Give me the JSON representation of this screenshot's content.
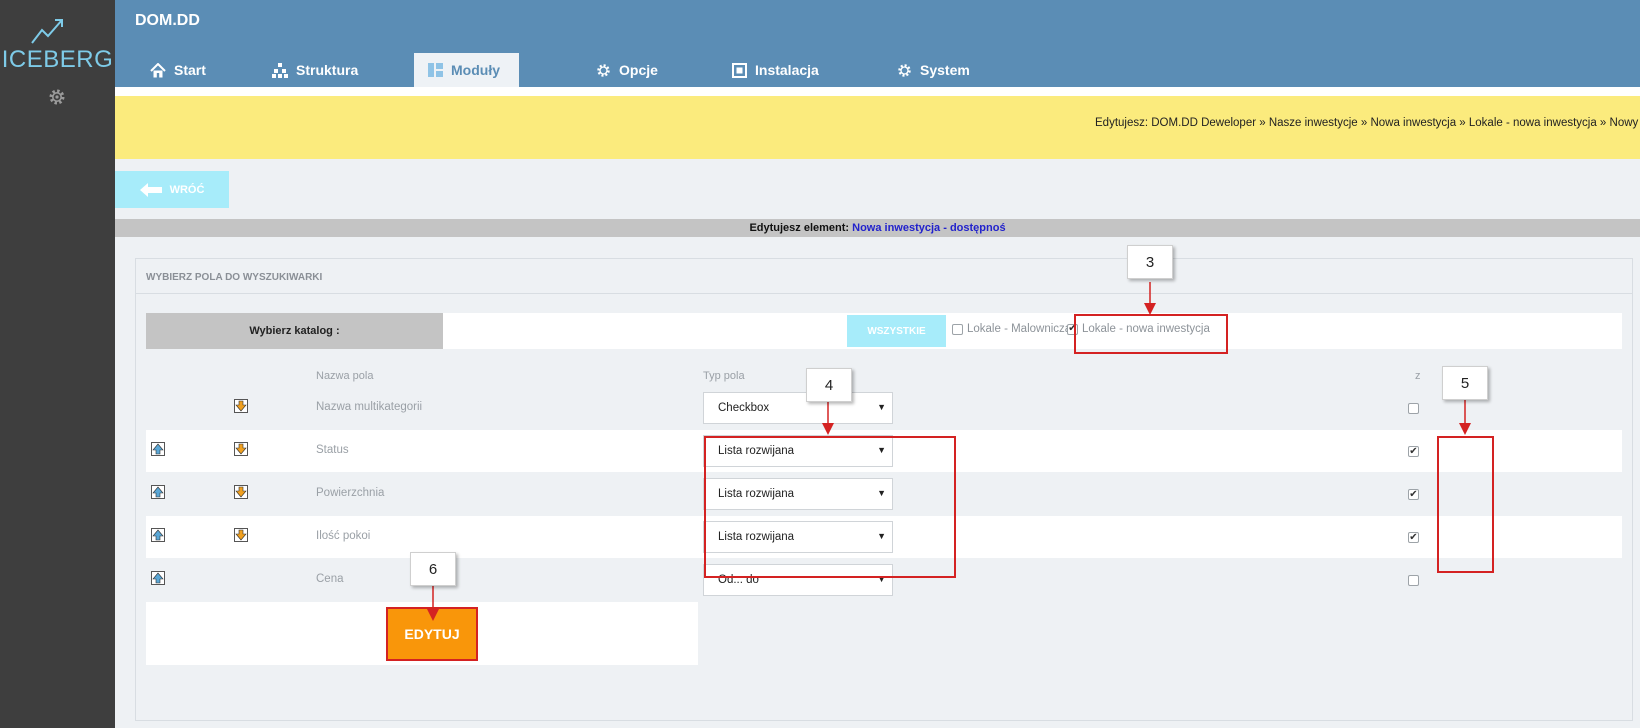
{
  "app": {
    "logo_text": "ICEBERG",
    "logo_icon": "trend-line-icon",
    "settings_icon": "gear-icon",
    "site_title": "DOM.DD"
  },
  "nav": {
    "tabs": [
      {
        "label": "Start",
        "icon": "home-icon",
        "active": false
      },
      {
        "label": "Struktura",
        "icon": "sitemap-icon",
        "active": false
      },
      {
        "label": "Moduły",
        "icon": "modules-icon",
        "active": true
      },
      {
        "label": "Opcje",
        "icon": "gear-icon",
        "active": false
      },
      {
        "label": "Instalacja",
        "icon": "install-icon",
        "active": false
      },
      {
        "label": "System",
        "icon": "gear-icon",
        "active": false
      }
    ]
  },
  "breadcrumb": "Edytujesz: DOM.DD Deweloper » Nasze inwestycje » Nowa inwestycja » Lokale - nowa inwestycja » Nowy apart",
  "back_button": {
    "label": "WRÓĆ",
    "icon": "arrow-left-icon"
  },
  "edit_bar": {
    "prefix": "Edytujesz element:",
    "element": "Nowa inwestycja - dostępnoś"
  },
  "panel": {
    "title": "WYBIERZ POLA DO WYSZUKIWARKI",
    "catalog_label": "Wybierz katalog :",
    "all_button": "WSZYSTKIE",
    "catalogs": [
      {
        "label": "Lokale - Malownicza",
        "checked": false
      },
      {
        "label": "Lokale - nowa inwestycja",
        "checked": true
      }
    ],
    "columns": {
      "name": "Nazwa pola",
      "type": "Typ pola",
      "last": "z"
    },
    "rows": [
      {
        "name": "Nazwa multikategorii",
        "type": "Checkbox",
        "checked": false,
        "up": false,
        "down": true
      },
      {
        "name": "Status",
        "type": "Lista rozwijana",
        "checked": true,
        "up": true,
        "down": true
      },
      {
        "name": "Powierzchnia",
        "type": "Lista rozwijana",
        "checked": true,
        "up": true,
        "down": true
      },
      {
        "name": "Ilość pokoi",
        "type": "Lista rozwijana",
        "checked": true,
        "up": true,
        "down": true
      },
      {
        "name": "Cena",
        "type": "Od... do",
        "checked": false,
        "up": true,
        "down": false
      }
    ],
    "edit_button": "EDYTUJ"
  },
  "annotations": {
    "callout_3": "3",
    "callout_4": "4",
    "callout_5": "5",
    "callout_6": "6",
    "highlight_color": "#d42222"
  }
}
